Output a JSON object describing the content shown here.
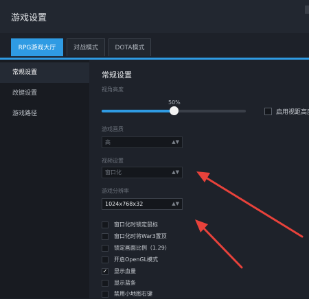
{
  "window": {
    "title": "游戏设置"
  },
  "tabs": [
    {
      "label": "RPG游戏大厅",
      "active": true
    },
    {
      "label": "对战模式",
      "active": false
    },
    {
      "label": "DOTA模式",
      "active": false
    }
  ],
  "sidebar": {
    "items": [
      {
        "label": "常规设置",
        "active": true
      },
      {
        "label": "改键设置",
        "active": false
      },
      {
        "label": "游戏路径",
        "active": false
      }
    ]
  },
  "content": {
    "section_title": "常规设置",
    "brightness": {
      "label": "视角高度",
      "value_text": "50%",
      "value": 0.5
    },
    "right_checkbox": {
      "label": "启用视距高度",
      "checked": false
    },
    "quality": {
      "label": "游戏画质",
      "value": "高"
    },
    "display": {
      "label": "视频设置",
      "value": "窗口化"
    },
    "resolution": {
      "label": "游戏分辨率",
      "value": "1024x768x32"
    },
    "options": [
      {
        "label": "窗口化时锁定鼠标",
        "checked": false
      },
      {
        "label": "窗口化时将War3置顶",
        "checked": false
      },
      {
        "label": "锁定画面比例（1.29）",
        "checked": false
      },
      {
        "label": "开启OpenGL模式",
        "checked": false
      },
      {
        "label": "显示血量",
        "checked": true
      },
      {
        "label": "显示蓝条",
        "checked": false
      },
      {
        "label": "禁用小地图右键",
        "checked": false
      }
    ]
  },
  "colors": {
    "accent": "#2f9be3",
    "annotation_arrow": "#e8423b"
  }
}
